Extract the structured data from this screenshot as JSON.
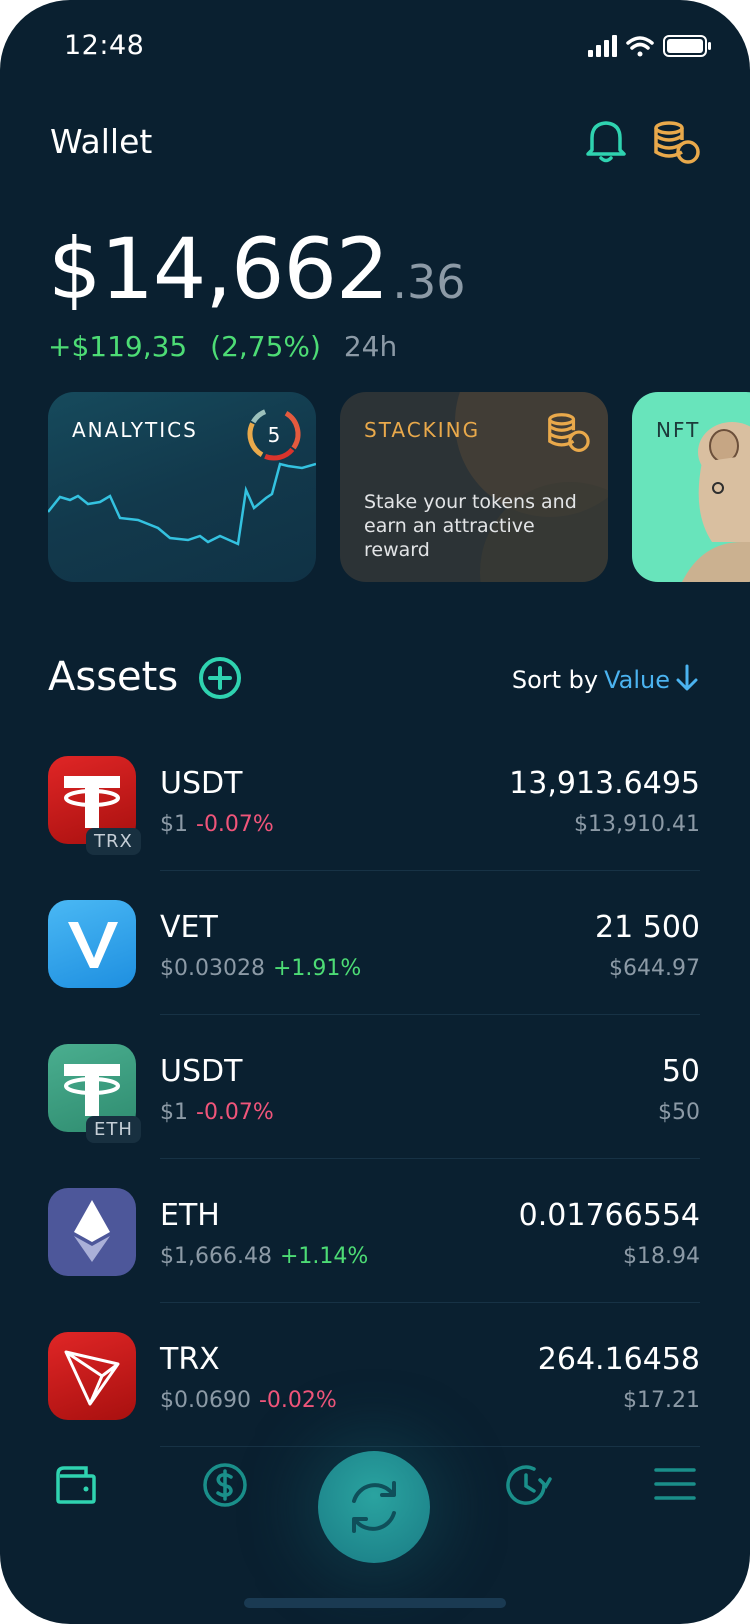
{
  "status_bar": {
    "time": "12:48"
  },
  "header": {
    "title": "Wallet"
  },
  "balance": {
    "main": "$14,662",
    "cents": ".36",
    "change_amount": "+$119,35",
    "change_percent": "(2,75%)",
    "period": "24h"
  },
  "cards": {
    "analytics": {
      "label": "ANALYTICS",
      "count": "5"
    },
    "stacking": {
      "label": "STACKING",
      "description": "Stake your tokens and earn an attractive reward"
    },
    "nft": {
      "label": "NFT"
    }
  },
  "assets": {
    "title": "Assets",
    "sort_label": "Sort by",
    "sort_value": "Value",
    "items": [
      {
        "name": "USDT",
        "chain": "TRX",
        "price": "$1",
        "change": "-0.07%",
        "amount": "13,913.6495",
        "fiat": "$13,910.41"
      },
      {
        "name": "VET",
        "chain": "",
        "price": "$0.03028",
        "change": "+1.91%",
        "amount": "21 500",
        "fiat": "$644.97"
      },
      {
        "name": "USDT",
        "chain": "ETH",
        "price": "$1",
        "change": "-0.07%",
        "amount": "50",
        "fiat": "$50"
      },
      {
        "name": "ETH",
        "chain": "",
        "price": "$1,666.48",
        "change": "+1.14%",
        "amount": "0.01766554",
        "fiat": "$18.94"
      },
      {
        "name": "TRX",
        "chain": "",
        "price": "$0.0690",
        "change": "-0.02%",
        "amount": "264.16458",
        "fiat": "$17.21"
      }
    ]
  },
  "icons": {
    "bell": "bell-icon",
    "coins": "coins-icon",
    "add": "plus-circle-icon",
    "sort": "arrow-down-icon",
    "tabs": [
      "wallet-icon",
      "dollar-icon",
      "swap-icon",
      "history-icon",
      "menu-icon"
    ]
  },
  "colors": {
    "background": "#0a2030",
    "accent_teal": "#2fd3b0",
    "accent_orange": "#e9a94b",
    "positive": "#4ddc75",
    "negative": "#f0557a",
    "link_blue": "#4bb3f0"
  }
}
